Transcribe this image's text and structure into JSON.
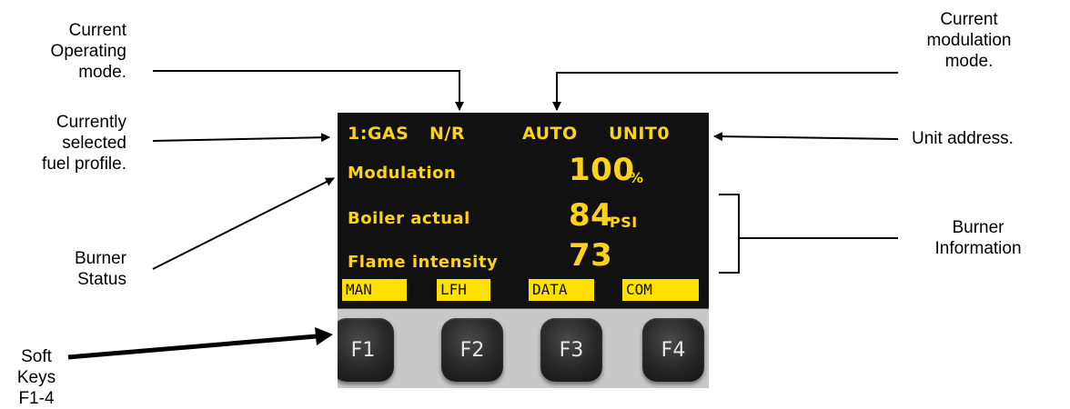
{
  "callouts": {
    "operating_mode": [
      "Current",
      "Operating",
      "mode."
    ],
    "fuel_profile": [
      "Currently",
      "selected",
      "fuel profile."
    ],
    "burner_status": [
      "Burner",
      "Status"
    ],
    "soft_keys": [
      "Soft Keys",
      "F1-4"
    ],
    "modulation_mode": [
      "Current",
      "modulation",
      "mode."
    ],
    "unit_address": [
      "Unit address."
    ],
    "burner_information": [
      "Burner",
      "Information"
    ]
  },
  "display": {
    "fuel": "1:GAS",
    "flag": "N/R",
    "modulation_mode": "AUTO",
    "unit": "UNIT0",
    "rows": [
      {
        "label": "Modulation",
        "value": "100",
        "unit": "%"
      },
      {
        "label": "Boiler actual",
        "value": "84",
        "unit": "PSI"
      },
      {
        "label": "Flame intensity",
        "value": "73",
        "unit": ""
      }
    ],
    "soft_labels": [
      "MAN",
      "LFH",
      "DATA",
      "COM"
    ]
  },
  "keys": [
    "F1",
    "F2",
    "F3",
    "F4"
  ],
  "colors": {
    "lcd_text": "#ffd21a",
    "soft_label_bg": "#ffe000",
    "screen_bg": "#111111",
    "housing": "#c8c8c8"
  }
}
